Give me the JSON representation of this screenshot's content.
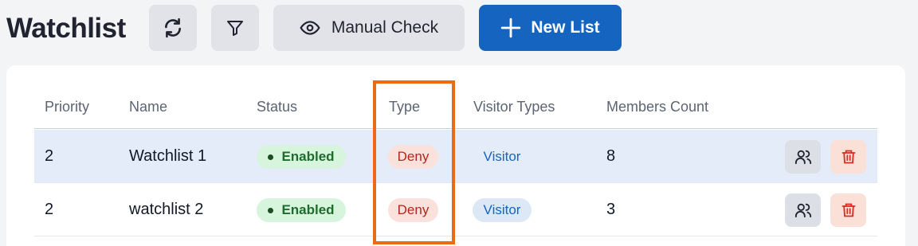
{
  "page": {
    "title": "Watchlist"
  },
  "toolbar": {
    "refresh_icon": "refresh-icon",
    "filter_icon": "filter-icon",
    "manual_check_label": "Manual Check",
    "manual_check_icon": "eye-icon",
    "new_list_label": "New List",
    "new_list_icon": "plus-icon"
  },
  "table": {
    "columns": [
      "Priority",
      "Name",
      "Status",
      "Type",
      "Visitor Types",
      "Members Count"
    ],
    "rows": [
      {
        "priority": "2",
        "name": "Watchlist 1",
        "status": "Enabled",
        "type": "Deny",
        "visitor_type": "Visitor",
        "members_count": "8",
        "selected": true
      },
      {
        "priority": "2",
        "name": "watchlist 2",
        "status": "Enabled",
        "type": "Deny",
        "visitor_type": "Visitor",
        "members_count": "3",
        "selected": false
      }
    ],
    "row_actions": [
      "users-icon",
      "trash-icon"
    ]
  },
  "colors": {
    "accent": "#1565c0",
    "highlight_border": "#ec6a12",
    "selected_row": "#e3ecf8",
    "enabled_badge": "#d7f5dc",
    "deny_badge": "#fbe1dc",
    "delete_button": "#fbe0d8"
  }
}
